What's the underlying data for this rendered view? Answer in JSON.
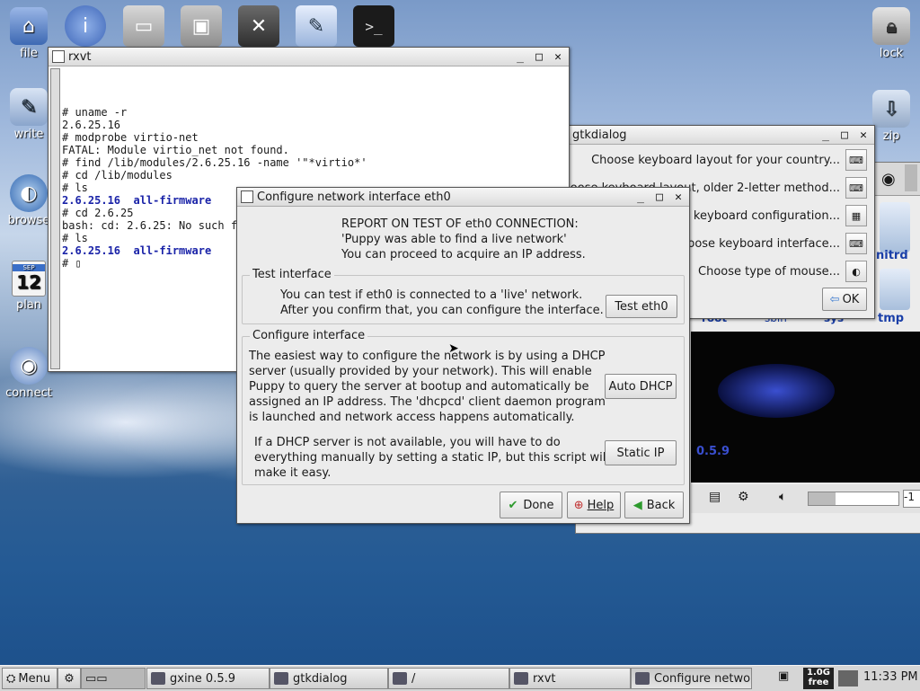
{
  "desktop": {
    "left_icons": [
      {
        "label": "file",
        "icon": "home-icon"
      },
      {
        "label": "write",
        "icon": "writer-icon"
      },
      {
        "label": "browse",
        "icon": "globe-icon"
      },
      {
        "label": "plan",
        "icon": "calendar-icon",
        "cal_month": "SEP",
        "cal_day": "12"
      },
      {
        "label": "connect",
        "icon": "network-globe-icon"
      }
    ],
    "right_icons": [
      {
        "label": "lock",
        "icon": "padlock-icon"
      },
      {
        "label": "zip",
        "icon": "archive-icon"
      }
    ],
    "top_icons": [
      "info-icon",
      "drive-icon",
      "package-icon",
      "settings-icon",
      "edit-icon",
      "console-icon"
    ]
  },
  "rxvt": {
    "title": "rxvt",
    "lines": [
      {
        "text": "# uname -r",
        "blue": false
      },
      {
        "text": "2.6.25.16",
        "blue": false
      },
      {
        "text": "# modprobe virtio-net",
        "blue": false
      },
      {
        "text": "FATAL: Module virtio_net not found.",
        "blue": false
      },
      {
        "text": "# find /lib/modules/2.6.25.16 -name '\"*virtio*'",
        "blue": false
      },
      {
        "text": "# cd /lib/modules",
        "blue": false
      },
      {
        "text": "# ls",
        "blue": false
      },
      {
        "text": "2.6.25.16  all-firmware",
        "blue": true
      },
      {
        "text": "# cd 2.6.25",
        "blue": false
      },
      {
        "text": "bash: cd: 2.6.25: No such file or directory",
        "blue": false
      },
      {
        "text": "# ls",
        "blue": false
      },
      {
        "text": "2.6.25.16  all-firmware",
        "blue": true
      },
      {
        "text": "# ▯",
        "blue": false
      }
    ]
  },
  "gtkdialog": {
    "title": "gtkdialog",
    "rows": [
      "Choose keyboard layout for your country...",
      "oose keyboard layout, older 2-letter method...",
      "g keyboard configuration...",
      "oose keyboard interface...",
      "Choose type of mouse..."
    ],
    "ok_label": "OK"
  },
  "filer": {
    "items": [
      "nitrd",
      "tmp"
    ],
    "partial_labels": [
      "root",
      "sbin",
      "sys"
    ]
  },
  "gxine": {
    "version": "0.5.9",
    "field_value": "-1"
  },
  "dialog": {
    "title": "Configure network interface eth0",
    "report_lines": [
      "REPORT ON TEST OF eth0 CONNECTION:",
      "'Puppy was able to find a live network'",
      "You can proceed to acquire an IP address."
    ],
    "test_frame_label": "Test interface",
    "test_text_lines": [
      "You can test if eth0 is connected to a 'live' network.",
      "After you confirm that, you can configure the interface."
    ],
    "test_button": "Test eth0",
    "config_frame_label": "Configure interface",
    "dhcp_text_lines": [
      "The easiest way to configure the network is by using a DHCP",
      "server (usually provided by your network). This will enable",
      "Puppy to query the server at bootup and automatically be",
      "assigned an IP address. The 'dhcpcd' client daemon program",
      "is launched and network access happens automatically."
    ],
    "dhcp_button": "Auto DHCP",
    "static_text_lines": [
      "If a DHCP server is not available, you will have to do",
      "everything manually by setting a static IP, but this script will",
      "make it easy."
    ],
    "static_button": "Static IP",
    "done_button": "Done",
    "help_button": "Help",
    "back_button": "Back"
  },
  "taskbar": {
    "menu_label": "Menu",
    "tasks": [
      "gxine 0.5.9",
      "gtkdialog",
      "/",
      "rxvt",
      "Configure netwo"
    ],
    "memory_top": "1.0G",
    "memory_bottom": "free",
    "clock": "11:33 PM"
  },
  "colors": {
    "terminal_blue": "#1a23a8",
    "xine_blue": "#3a4fd0"
  }
}
